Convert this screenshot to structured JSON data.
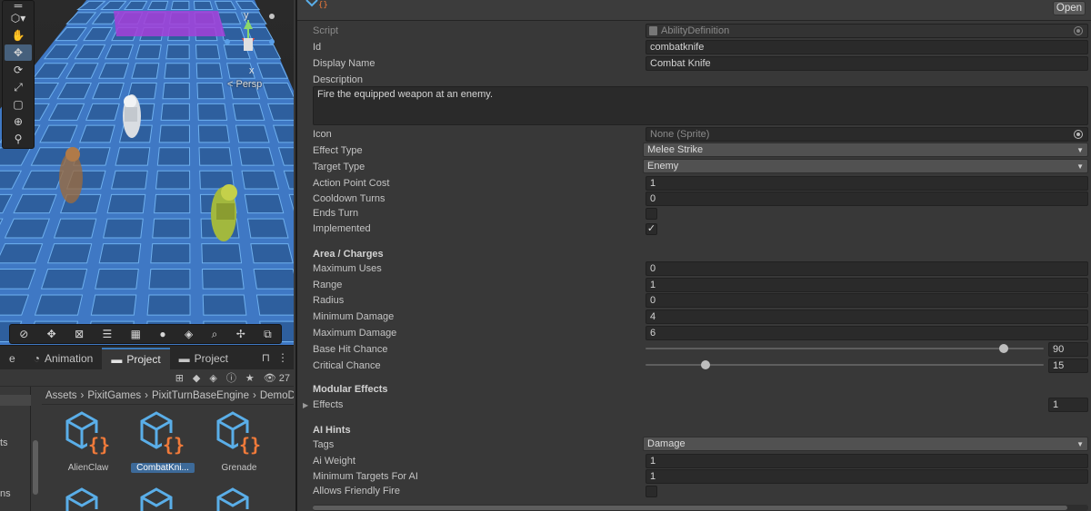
{
  "scene": {
    "persp_label": "< Persp",
    "gizmo_axes": {
      "y": "y",
      "x": "x"
    }
  },
  "project_panel": {
    "tabs": [
      {
        "label": "e"
      },
      {
        "label": "Animation"
      },
      {
        "label": "Project"
      },
      {
        "label": "Project"
      }
    ],
    "hidden_count": "27",
    "breadcrumb": [
      "Assets",
      "PixitGames",
      "PixitTurnBaseEngine",
      "DemoD"
    ],
    "sidebar_rows": [
      "ts",
      "ns"
    ],
    "assets": [
      {
        "label": "AlienClaw"
      },
      {
        "label": "CombatKni..."
      },
      {
        "label": "Grenade"
      }
    ]
  },
  "inspector": {
    "open_label": "Open",
    "script_label": "Script",
    "script_value": "AbilityDefinition",
    "id_label": "Id",
    "id_value": "combatknife",
    "display_name_label": "Display Name",
    "display_name_value": "Combat Knife",
    "description_label": "Description",
    "description_value": "Fire the equipped weapon at an enemy.",
    "icon_label": "Icon",
    "icon_value": "None (Sprite)",
    "effect_type_label": "Effect Type",
    "effect_type_value": "Melee Strike",
    "target_type_label": "Target Type",
    "target_type_value": "Enemy",
    "action_point_cost_label": "Action Point Cost",
    "action_point_cost_value": "1",
    "cooldown_turns_label": "Cooldown Turns",
    "cooldown_turns_value": "0",
    "ends_turn_label": "Ends Turn",
    "ends_turn_checked": false,
    "implemented_label": "Implemented",
    "implemented_checked": true,
    "area_header": "Area / Charges",
    "maximum_uses_label": "Maximum Uses",
    "maximum_uses_value": "0",
    "range_label": "Range",
    "range_value": "1",
    "radius_label": "Radius",
    "radius_value": "0",
    "min_damage_label": "Minimum Damage",
    "min_damage_value": "4",
    "max_damage_label": "Maximum Damage",
    "max_damage_value": "6",
    "base_hit_label": "Base Hit Chance",
    "base_hit_value": "90",
    "base_hit_fraction": 0.9,
    "crit_label": "Critical Chance",
    "crit_value": "15",
    "crit_fraction": 0.15,
    "modular_header": "Modular Effects",
    "effects_label": "Effects",
    "effects_count": "1",
    "ai_header": "AI Hints",
    "tags_label": "Tags",
    "tags_value": "Damage",
    "ai_weight_label": "Ai Weight",
    "ai_weight_value": "1",
    "min_targets_label": "Minimum Targets For AI",
    "min_targets_value": "1",
    "friendly_fire_label": "Allows Friendly Fire",
    "friendly_fire_checked": false
  },
  "colors": {
    "accent": "#3a79bb",
    "selection": "#3d6a99",
    "asset_icon_blue": "#5aaee8",
    "asset_icon_orange": "#f07a3a"
  }
}
